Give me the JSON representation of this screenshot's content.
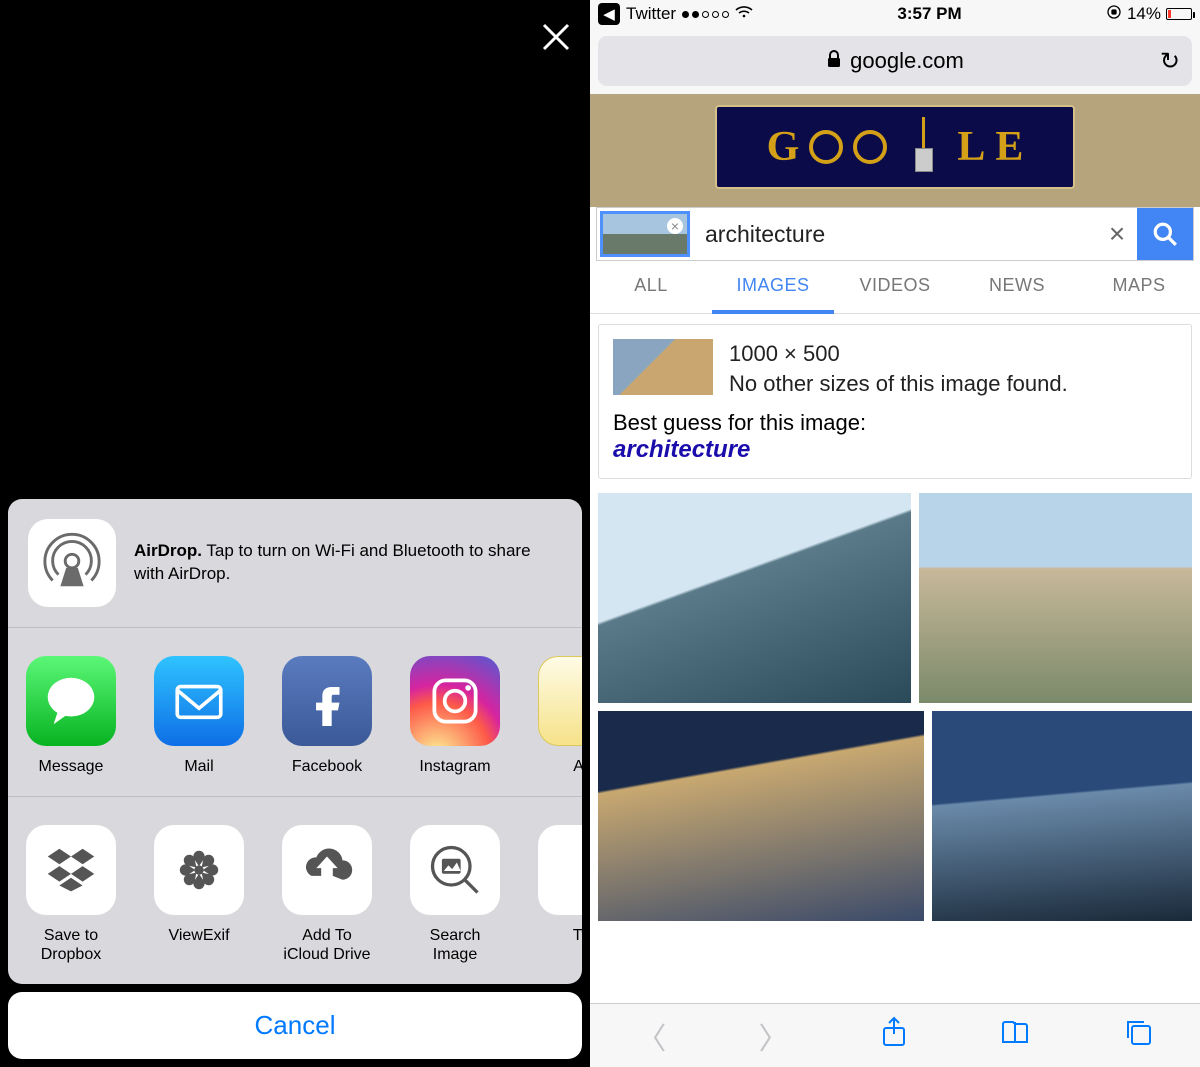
{
  "left": {
    "airdrop_bold": "AirDrop.",
    "airdrop_text": " Tap to turn on Wi-Fi and Bluetooth to share with AirDrop.",
    "share_apps": [
      {
        "label": "Message",
        "icon": "message"
      },
      {
        "label": "Mail",
        "icon": "mail"
      },
      {
        "label": "Facebook",
        "icon": "facebook"
      },
      {
        "label": "Instagram",
        "icon": "instagram"
      },
      {
        "label": "Ad",
        "icon": "notes"
      }
    ],
    "actions": [
      {
        "label": "Save to\nDropbox",
        "icon": "dropbox"
      },
      {
        "label": "ViewExif",
        "icon": "gear-flower"
      },
      {
        "label": "Add To\niCloud Drive",
        "icon": "cloud-upload"
      },
      {
        "label": "Search\nImage",
        "icon": "image-search"
      },
      {
        "label": "Tw",
        "icon": "generic"
      }
    ],
    "cancel_label": "Cancel"
  },
  "right": {
    "status": {
      "back_app": "Twitter",
      "time": "3:57 PM",
      "battery_text": "14%"
    },
    "url_display": "google.com",
    "search_query": "architecture",
    "tabs": [
      {
        "label": "ALL",
        "active": false
      },
      {
        "label": "IMAGES",
        "active": true
      },
      {
        "label": "VIDEOS",
        "active": false
      },
      {
        "label": "NEWS",
        "active": false
      },
      {
        "label": "MAPS",
        "active": false
      }
    ],
    "result": {
      "dimensions": "1000 × 500",
      "no_other": "No other sizes of this image found.",
      "best_guess_label": "Best guess for this image:",
      "best_guess_value": "architecture"
    }
  }
}
